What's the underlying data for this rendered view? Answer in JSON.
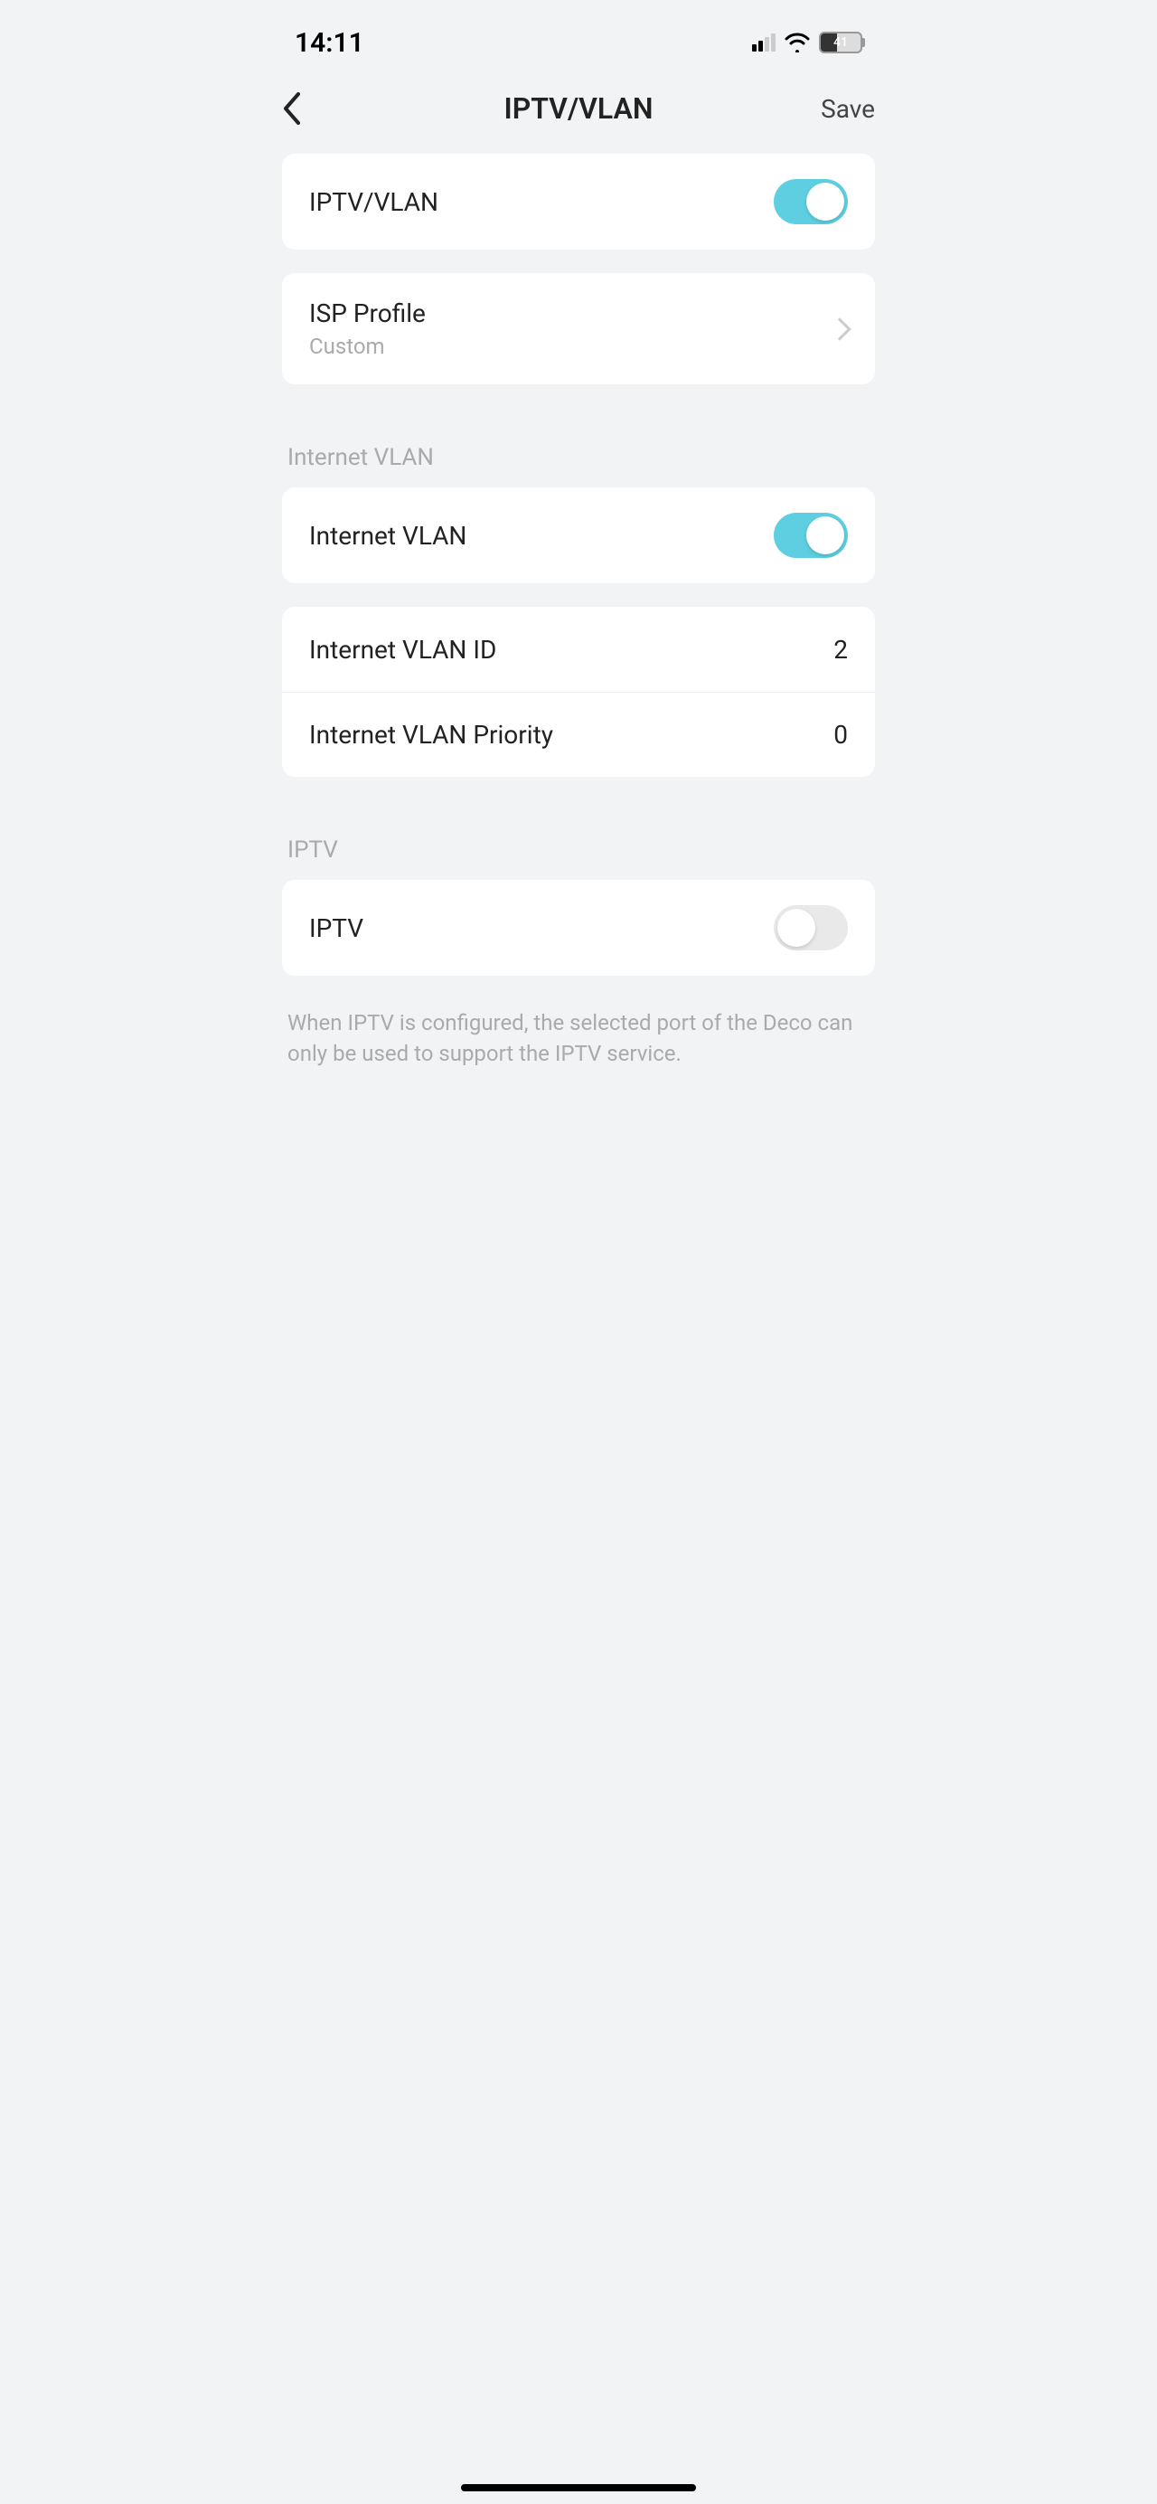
{
  "status": {
    "time": "14:11",
    "battery": "41"
  },
  "nav": {
    "title": "IPTV/VLAN",
    "save": "Save"
  },
  "rows": {
    "iptv_vlan_master": {
      "label": "IPTV/VLAN",
      "on": true
    },
    "isp_profile": {
      "label": "ISP Profile",
      "value": "Custom"
    },
    "internet_vlan_toggle": {
      "label": "Internet VLAN",
      "on": true
    },
    "internet_vlan_id": {
      "label": "Internet VLAN ID",
      "value": "2"
    },
    "internet_vlan_priority": {
      "label": "Internet VLAN Priority",
      "value": "0"
    },
    "iptv_toggle": {
      "label": "IPTV",
      "on": false
    }
  },
  "sections": {
    "internet_vlan": "Internet VLAN",
    "iptv": "IPTV"
  },
  "footer_note": "When IPTV is configured, the selected port of the Deco can only be used to support the IPTV service."
}
